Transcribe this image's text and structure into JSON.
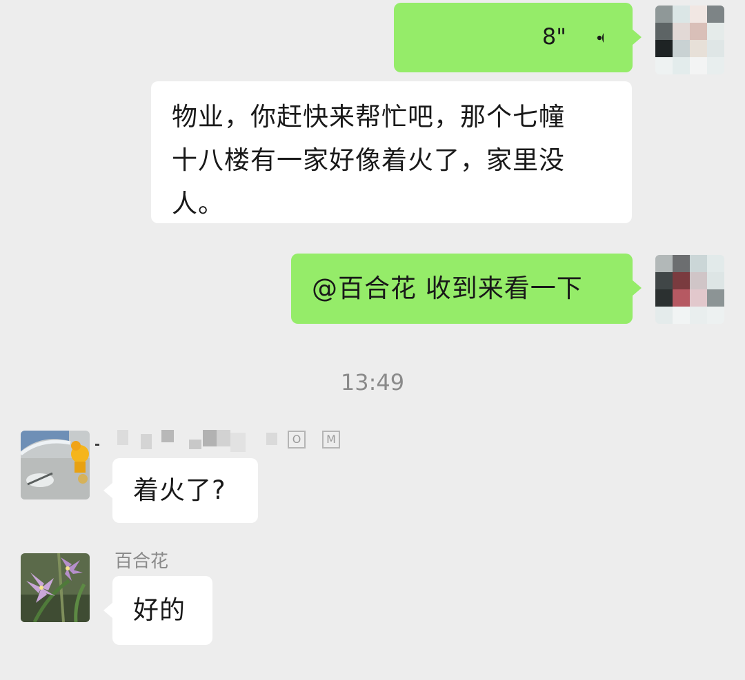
{
  "chat": {
    "messages": [
      {
        "side": "right",
        "type": "voice",
        "duration": "8\""
      },
      {
        "side": "right",
        "type": "text",
        "text": "物业，你赶快来帮忙吧，那个七幢十八楼有一家好像着火了，家里没人。"
      },
      {
        "side": "right",
        "type": "text",
        "text": "@百合花 收到来看一下"
      },
      {
        "side": "left",
        "type": "text",
        "sender": "",
        "text": "着火了?"
      },
      {
        "side": "left",
        "type": "text",
        "sender": "百合花",
        "text": "好的"
      }
    ],
    "timestamp": "13:49",
    "sender_tags": [
      "O",
      "M"
    ],
    "line1": "物业，你赶快来帮忙吧，那个七幢",
    "line2": "十八楼有一家好像着火了，家里没",
    "line3": "人。"
  },
  "icons": {
    "voice": "voice-wave-icon"
  },
  "colors": {
    "background": "#ededed",
    "outgoing_bubble": "#95ec69",
    "incoming_bubble": "#ffffff",
    "text": "#191919",
    "meta_text": "#8a8a8a"
  }
}
